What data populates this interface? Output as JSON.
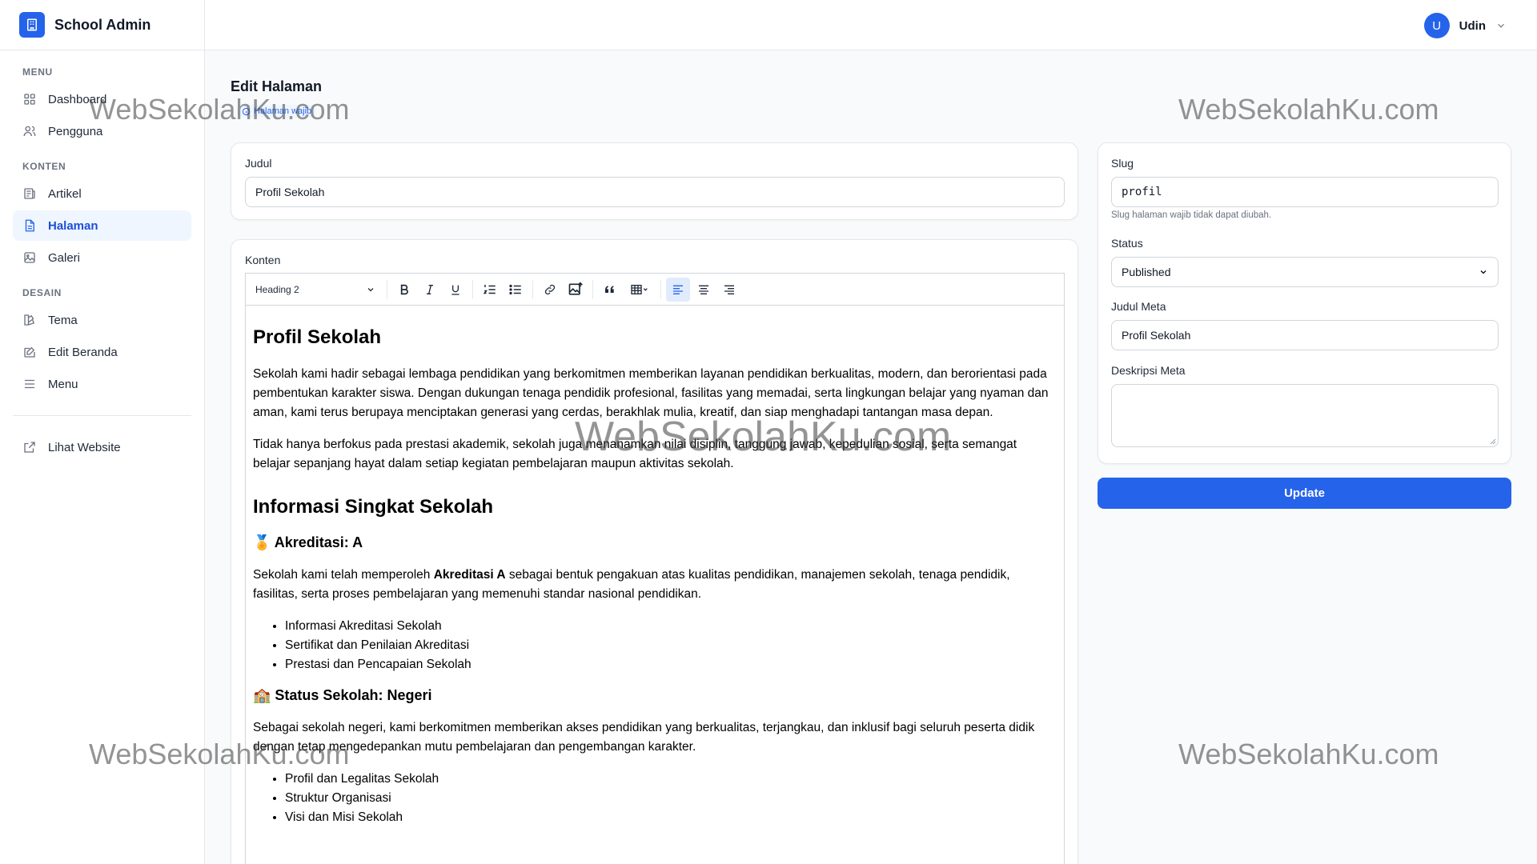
{
  "brand": {
    "title": "School Admin"
  },
  "sidebar": {
    "sections": {
      "menu": "MENU",
      "konten": "KONTEN",
      "desain": "DESAIN"
    },
    "items": {
      "dashboard": "Dashboard",
      "pengguna": "Pengguna",
      "artikel": "Artikel",
      "halaman": "Halaman",
      "galeri": "Galeri",
      "tema": "Tema",
      "edit_beranda": "Edit Beranda",
      "menu": "Menu",
      "lihat_website": "Lihat Website"
    },
    "active_item": "Halaman"
  },
  "header": {
    "user_initial": "U",
    "user_name": "Udin"
  },
  "page": {
    "title": "Edit Halaman",
    "badge": "Halaman wajib"
  },
  "form": {
    "judul_label": "Judul",
    "judul_value": "Profil Sekolah",
    "konten_label": "Konten",
    "heading_select": "Heading 2",
    "slug_label": "Slug",
    "slug_value": "profil",
    "slug_hint": "Slug halaman wajib tidak dapat diubah.",
    "status_label": "Status",
    "status_value": "Published",
    "meta_title_label": "Judul Meta",
    "meta_title_value": "Profil Sekolah",
    "meta_desc_label": "Deskripsi Meta",
    "meta_desc_value": "",
    "update_label": "Update"
  },
  "content": {
    "h1": "Profil Sekolah",
    "p1": "Sekolah kami hadir sebagai lembaga pendidikan yang berkomitmen memberikan layanan pendidikan berkualitas, modern, dan berorientasi pada pembentukan karakter siswa. Dengan dukungan tenaga pendidik profesional, fasilitas yang memadai, serta lingkungan belajar yang nyaman dan aman, kami terus berupaya menciptakan generasi yang cerdas, berakhlak mulia, kreatif, dan siap menghadapi tantangan masa depan.",
    "p2": "Tidak hanya berfokus pada prestasi akademik, sekolah juga menanamkan nilai disiplin, tanggung jawab, kepedulian sosial, serta semangat belajar sepanjang hayat dalam setiap kegiatan pembelajaran maupun aktivitas sekolah.",
    "h2": "Informasi Singkat Sekolah",
    "h3a": "🏅 Akreditasi: A",
    "p3_pre": "Sekolah kami telah memperoleh ",
    "p3_bold": "Akreditasi A",
    "p3_post": " sebagai bentuk pengakuan atas kualitas pendidikan, manajemen sekolah, tenaga pendidik, fasilitas, serta proses pembelajaran yang memenuhi standar nasional pendidikan.",
    "list1": [
      "Informasi Akreditasi Sekolah",
      "Sertifikat dan Penilaian Akreditasi",
      "Prestasi dan Pencapaian Sekolah"
    ],
    "h3b": "🏫 Status Sekolah: Negeri",
    "p4": "Sebagai sekolah negeri, kami berkomitmen memberikan akses pendidikan yang berkualitas, terjangkau, dan inklusif bagi seluruh peserta didik dengan tetap mengedepankan mutu pembelajaran dan pengembangan karakter.",
    "list2": [
      "Profil dan Legalitas Sekolah",
      "Struktur Organisasi",
      "Visi dan Misi Sekolah"
    ]
  },
  "watermark": "WebSekolahKu.com",
  "colors": {
    "accent": "#2563eb",
    "active_bg": "#eff6ff"
  }
}
